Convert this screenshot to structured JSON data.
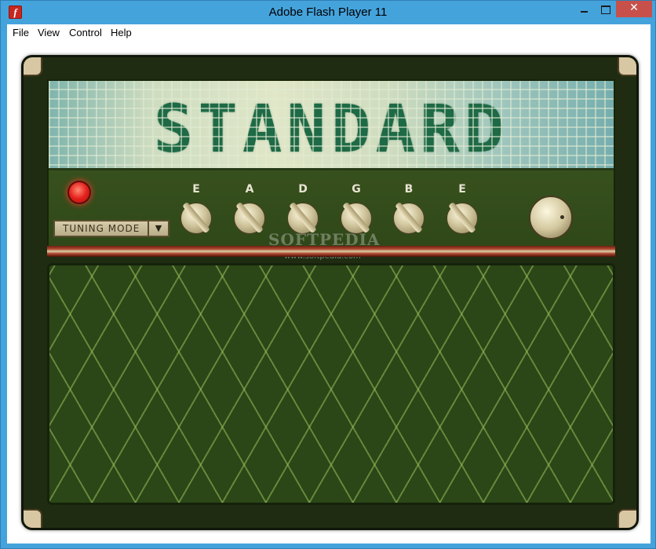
{
  "window": {
    "title": "Adobe Flash Player 11",
    "icon": "flash-icon",
    "close_glyph": "✕"
  },
  "menu": {
    "items": [
      "File",
      "View",
      "Control",
      "Help"
    ]
  },
  "tuner": {
    "display_text": "STANDARD",
    "mode_label": "TUNING MODE",
    "mode_arrow": "▼",
    "strings": [
      "E",
      "A",
      "D",
      "G",
      "B",
      "E"
    ]
  },
  "watermark": {
    "brand": "SOFTPEDIA",
    "url": "www.softpedia.com"
  },
  "colors": {
    "titlebar": "#45a3dc",
    "close": "#c7504b",
    "display_text": "#1e6a46",
    "led": "#e5201c",
    "grille": "#2b4617"
  }
}
